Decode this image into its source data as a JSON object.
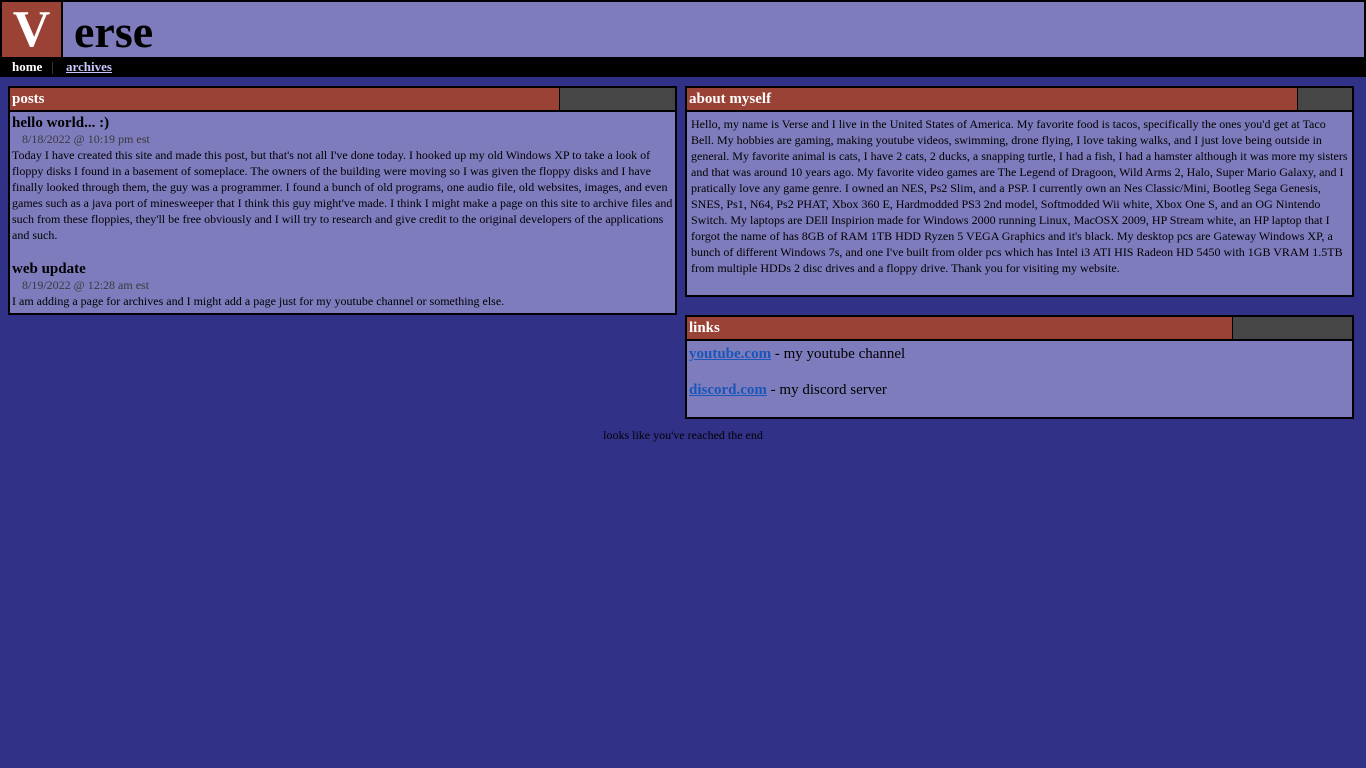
{
  "header": {
    "logo_letter": "V",
    "logo_rest": "erse"
  },
  "nav": {
    "home": "home",
    "archives": "archives"
  },
  "posts_panel": {
    "title": "posts",
    "posts": [
      {
        "title": "hello world... :)",
        "date": "8/18/2022 @ 10:19 pm est",
        "text": "Today I have created this site and made this post, but that's not all I've done today. I hooked up my old Windows XP to take a look of floppy disks I found in a basement of someplace. The owners of the building were moving so I was given the floppy disks and I have finally looked through them, the guy was a programmer. I found a bunch of old programs, one audio file, old websites, images, and even games such as a java port of minesweeper that I think this guy might've made. I think I might make a page on this site to archive files and such from these floppies, they'll be free obviously and I will try to research and give credit to the original developers of the applications and such."
      },
      {
        "title": "web update",
        "date": "8/19/2022 @ 12:28 am est",
        "text": "I am adding a page for archives and I might add a page just for my youtube channel or something else."
      }
    ]
  },
  "about_panel": {
    "title": "about myself",
    "text": "Hello, my name is Verse and I live in the United States of America. My favorite food is tacos, specifically the ones you'd get at Taco Bell. My hobbies are gaming, making youtube videos, swimming, drone flying, I love taking walks, and I just love being outside in general. My favorite animal is cats, I have 2 cats, 2 ducks, a snapping turtle, I had a fish, I had a hamster although it was more my sisters and that was around 10 years ago. My favorite video games are The Legend of Dragoon, Wild Arms 2, Halo, Super Mario Galaxy, and I pratically love any game genre. I owned an NES, Ps2 Slim, and a PSP. I currently own an Nes Classic/Mini, Bootleg Sega Genesis, SNES, Ps1, N64, Ps2 PHAT, Xbox 360 E, Hardmodded PS3 2nd model, Softmodded Wii white, Xbox One S, and an OG Nintendo Switch. My laptops are DEll Inspirion made for Windows 2000 running Linux, MacOSX 2009, HP Stream white, an HP laptop that I forgot the name of has 8GB of RAM 1TB HDD Ryzen 5 VEGA Graphics and it's black. My desktop pcs are Gateway Windows XP, a bunch of different Windows 7s, and one I've built from older pcs which has Intel i3 ATI HIS Radeon HD 5450 with 1GB VRAM 1.5TB from multiple HDDs 2 disc drives and a floppy drive. Thank you for visiting my website."
  },
  "links_panel": {
    "title": "links",
    "links": [
      {
        "label": "youtube.com",
        "desc": " - my youtube channel"
      },
      {
        "label": "discord.com",
        "desc": " - my discord server"
      }
    ]
  },
  "footer": "looks like you've reached the end",
  "colors": {
    "background": "#313188",
    "panel": "#7e7cbc",
    "accent": "#9b4236",
    "dark_tab": "#464646"
  }
}
